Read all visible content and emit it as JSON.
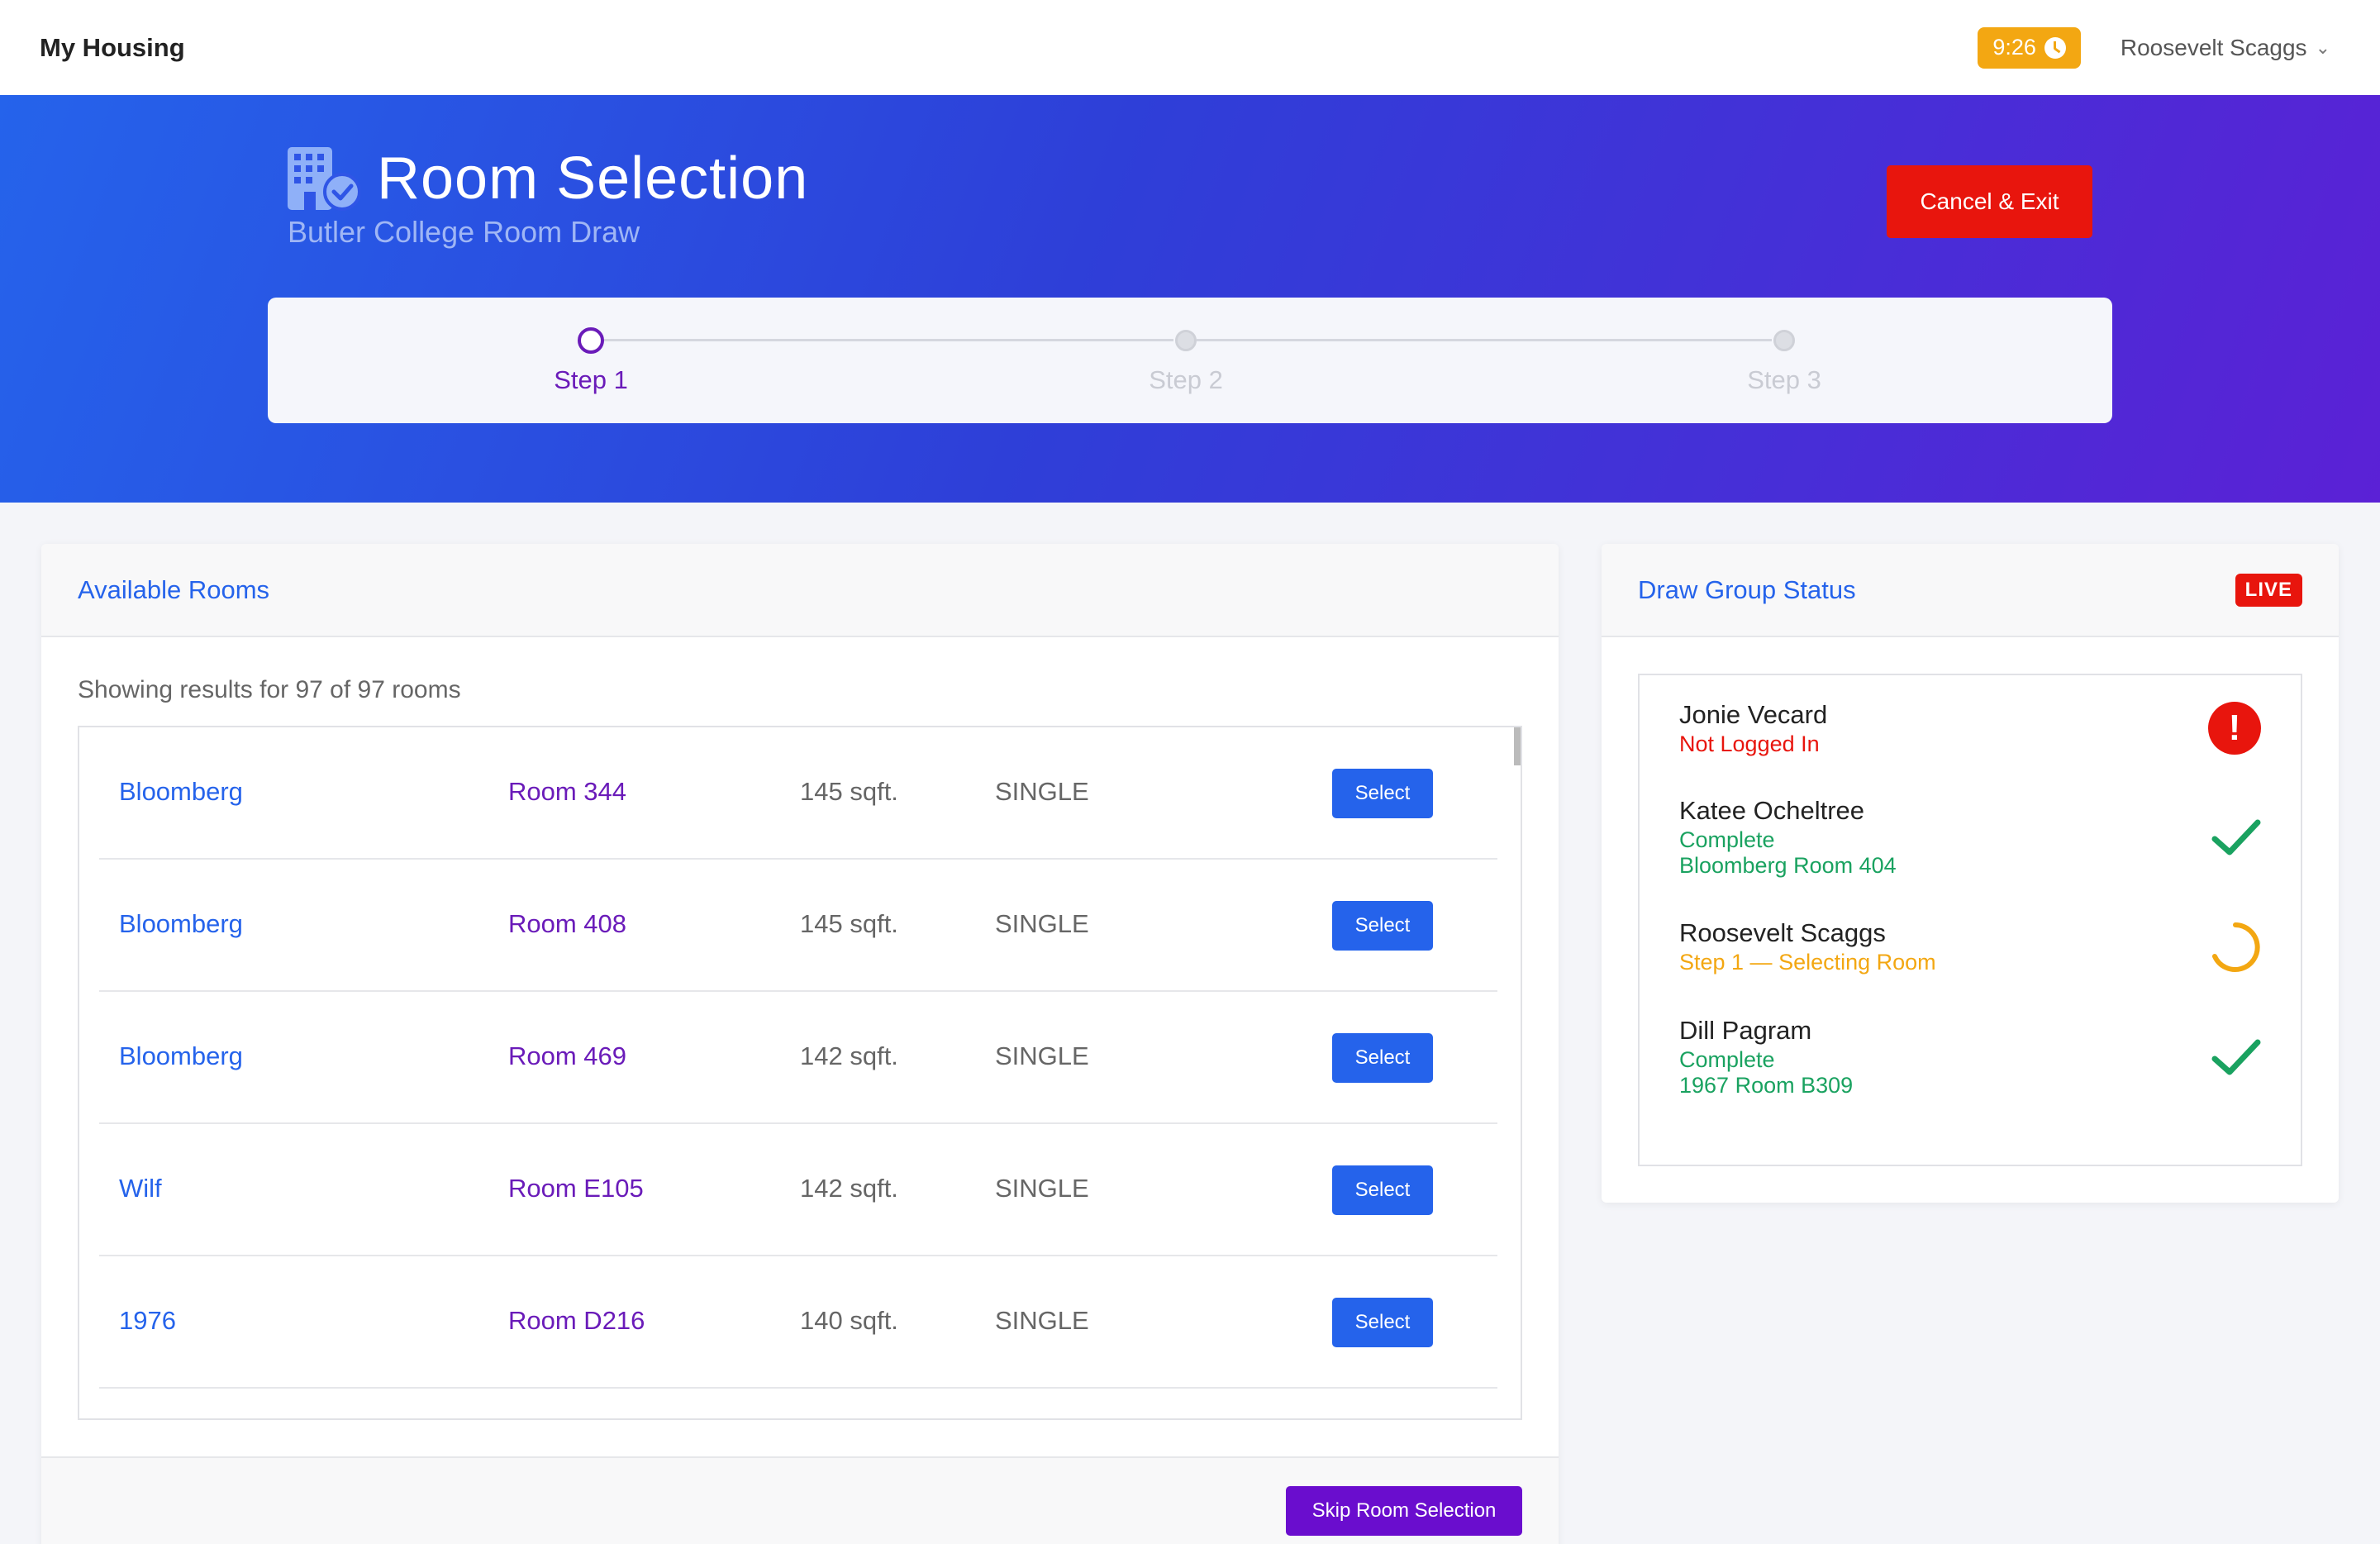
{
  "app": {
    "title": "My Housing"
  },
  "timer": {
    "value": "9:26"
  },
  "user": {
    "name": "Roosevelt Scaggs"
  },
  "hero": {
    "title": "Room Selection",
    "subtitle": "Butler College Room Draw",
    "cancel_label": "Cancel & Exit"
  },
  "steps": {
    "current": 1,
    "items": [
      {
        "label": "Step 1"
      },
      {
        "label": "Step 2"
      },
      {
        "label": "Step 3"
      }
    ]
  },
  "rooms": {
    "title": "Available Rooms",
    "results_text": "Showing results for 97 of 97 rooms",
    "select_label": "Select",
    "skip_label": "Skip Room Selection",
    "items": [
      {
        "building": "Bloomberg",
        "room": "Room 344",
        "size": "145 sqft.",
        "type": "SINGLE"
      },
      {
        "building": "Bloomberg",
        "room": "Room 408",
        "size": "145 sqft.",
        "type": "SINGLE"
      },
      {
        "building": "Bloomberg",
        "room": "Room 469",
        "size": "142 sqft.",
        "type": "SINGLE"
      },
      {
        "building": "Wilf",
        "room": "Room E105",
        "size": "142 sqft.",
        "type": "SINGLE"
      },
      {
        "building": "1976",
        "room": "Room D216",
        "size": "140 sqft.",
        "type": "SINGLE"
      }
    ]
  },
  "draw_group": {
    "title": "Draw Group Status",
    "badge": "LIVE",
    "members": [
      {
        "name": "Jonie Vecard",
        "status": "Not Logged In",
        "room": "",
        "state": "error"
      },
      {
        "name": "Katee Ocheltree",
        "status": "Complete",
        "room": "Bloomberg Room 404",
        "state": "complete"
      },
      {
        "name": "Roosevelt Scaggs",
        "status": "Step 1 — Selecting Room",
        "room": "",
        "state": "in-progress"
      },
      {
        "name": "Dill Pagram",
        "status": "Complete",
        "room": "1967 Room B309",
        "state": "complete"
      }
    ]
  },
  "colors": {
    "primary": "#2563eb",
    "purple": "#6a1bb9",
    "danger": "#e8150d",
    "success": "#1aa260",
    "warning": "#f3a712"
  }
}
